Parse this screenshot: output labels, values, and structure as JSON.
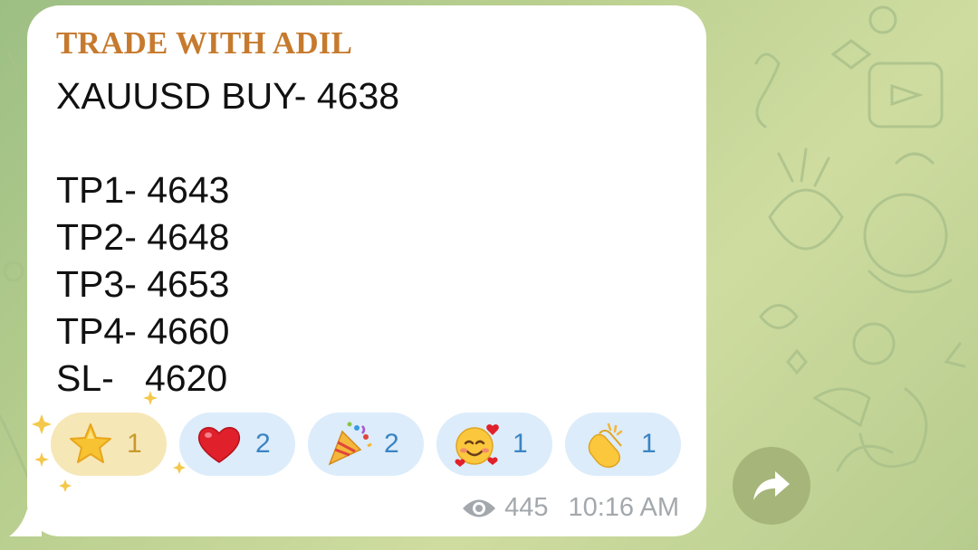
{
  "message": {
    "sender": "TRADE WITH ADIL",
    "lines": [
      "XAUUSD BUY- 4638",
      "",
      "TP1- 4643",
      "TP2- 4648",
      "TP3- 4653",
      "TP4- 4660",
      "SL-   4620"
    ],
    "views": "445",
    "time": "10:16 AM"
  },
  "reactions": [
    {
      "emoji": "star",
      "count": "1",
      "chosen": true
    },
    {
      "emoji": "red-heart",
      "count": "2",
      "chosen": false
    },
    {
      "emoji": "party-popper",
      "count": "2",
      "chosen": false
    },
    {
      "emoji": "smiling-face-with-hearts",
      "count": "1",
      "chosen": false
    },
    {
      "emoji": "clapping-hands",
      "count": "1",
      "chosen": false
    }
  ],
  "colors": {
    "sender": "#c67a2e",
    "reaction_bg": "#dcecfa",
    "reaction_chosen_bg": "#f6e7b6",
    "reaction_count": "#3a84c4",
    "meta": "#a3a8ad",
    "forward_button": "#a6b57a"
  }
}
